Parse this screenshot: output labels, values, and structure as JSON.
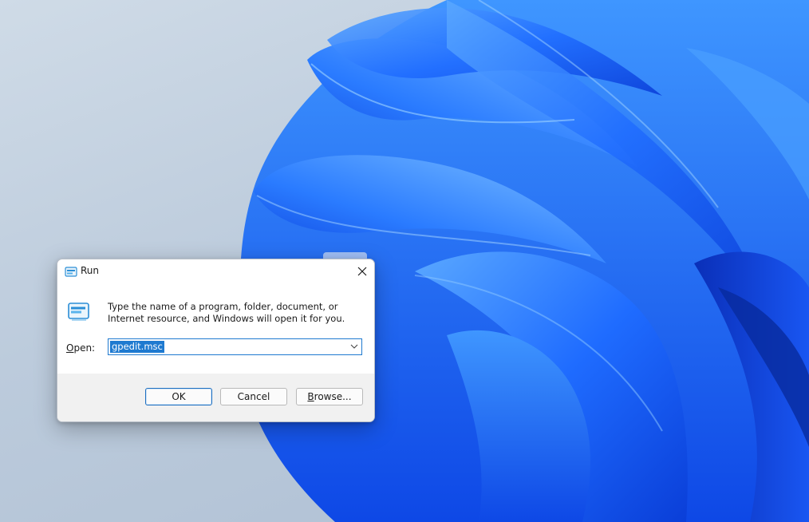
{
  "dialog": {
    "title": "Run",
    "description": "Type the name of a program, folder, document, or Internet resource, and Windows will open it for you.",
    "open_label_accel": "O",
    "open_label_rest": "pen:",
    "open_value": "gpedit.msc",
    "ok_label": "OK",
    "cancel_label": "Cancel",
    "browse_accel": "B",
    "browse_rest": "rowse..."
  },
  "icons": {
    "title_icon": "run-app-icon",
    "big_icon": "run-app-icon",
    "close": "close-icon",
    "dropdown": "chevron-down-icon"
  },
  "colors": {
    "accent": "#1f7ad0",
    "wallpaper_blue": "#1a62ff"
  }
}
